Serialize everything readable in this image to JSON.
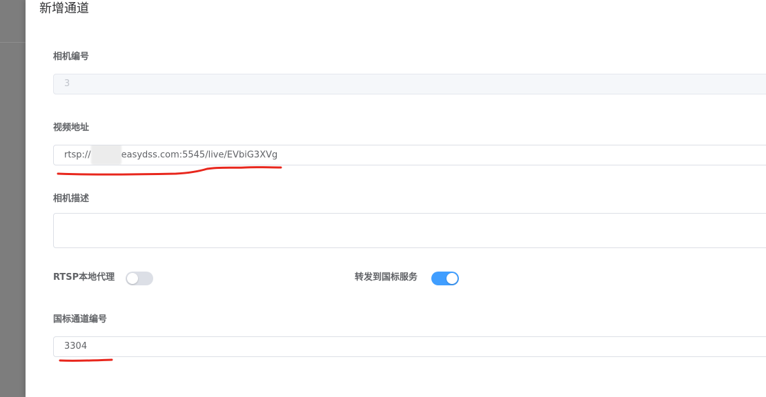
{
  "dialog": {
    "title": "新增通道"
  },
  "form": {
    "camera_id": {
      "label": "相机编号",
      "value": "3"
    },
    "video_url": {
      "label": "视频地址",
      "prefix": "rtsp://",
      "suffix": "easydss.com:5545/live/EVbiG3XVg"
    },
    "camera_desc": {
      "label": "相机描述",
      "value": ""
    },
    "rtsp_proxy": {
      "label": "RTSP本地代理",
      "enabled": false
    },
    "forward_gb": {
      "label": "转发到国标服务",
      "enabled": true
    },
    "gb_channel_id": {
      "label": "国标通道编号",
      "value": "3304"
    }
  },
  "colors": {
    "accent": "#409eff",
    "annotation": "#e8261c"
  }
}
